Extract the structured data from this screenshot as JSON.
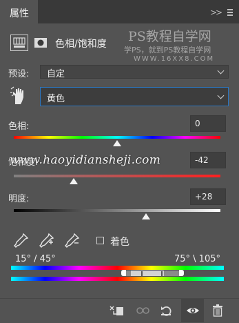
{
  "panel": {
    "tab_label": "属性",
    "collapse_glyph": ">>",
    "adjustment_title": "色相/饱和度"
  },
  "watermark": {
    "line1": "PS教程自学网",
    "line2": "学PS，就到PS教程自学网",
    "line3": "WWW.16XX8.COM",
    "line4": "www.haoyidiansheji.com"
  },
  "preset": {
    "label": "预设:",
    "value": "自定"
  },
  "channel": {
    "value": "黄色"
  },
  "hue": {
    "label": "色相:",
    "value": "0",
    "slider_fraction": 0.5
  },
  "saturation": {
    "label": "饱和度:",
    "value": "-42",
    "slider_fraction": 0.29
  },
  "lightness": {
    "label": "明度:",
    "value": "+28",
    "slider_fraction": 0.64
  },
  "colorize": {
    "label": "着色",
    "checked": false
  },
  "range": {
    "left": "15° / 45°",
    "right": "75° \\ 105°"
  },
  "colors": {
    "panel_bg": "#535353",
    "tabbar_bg": "#393939",
    "focus_border": "#2c78c4"
  },
  "icons": {
    "toolbar": [
      "clip-to-layer-icon",
      "view-previous-icon",
      "reset-icon",
      "visibility-eye-icon",
      "delete-icon"
    ]
  }
}
